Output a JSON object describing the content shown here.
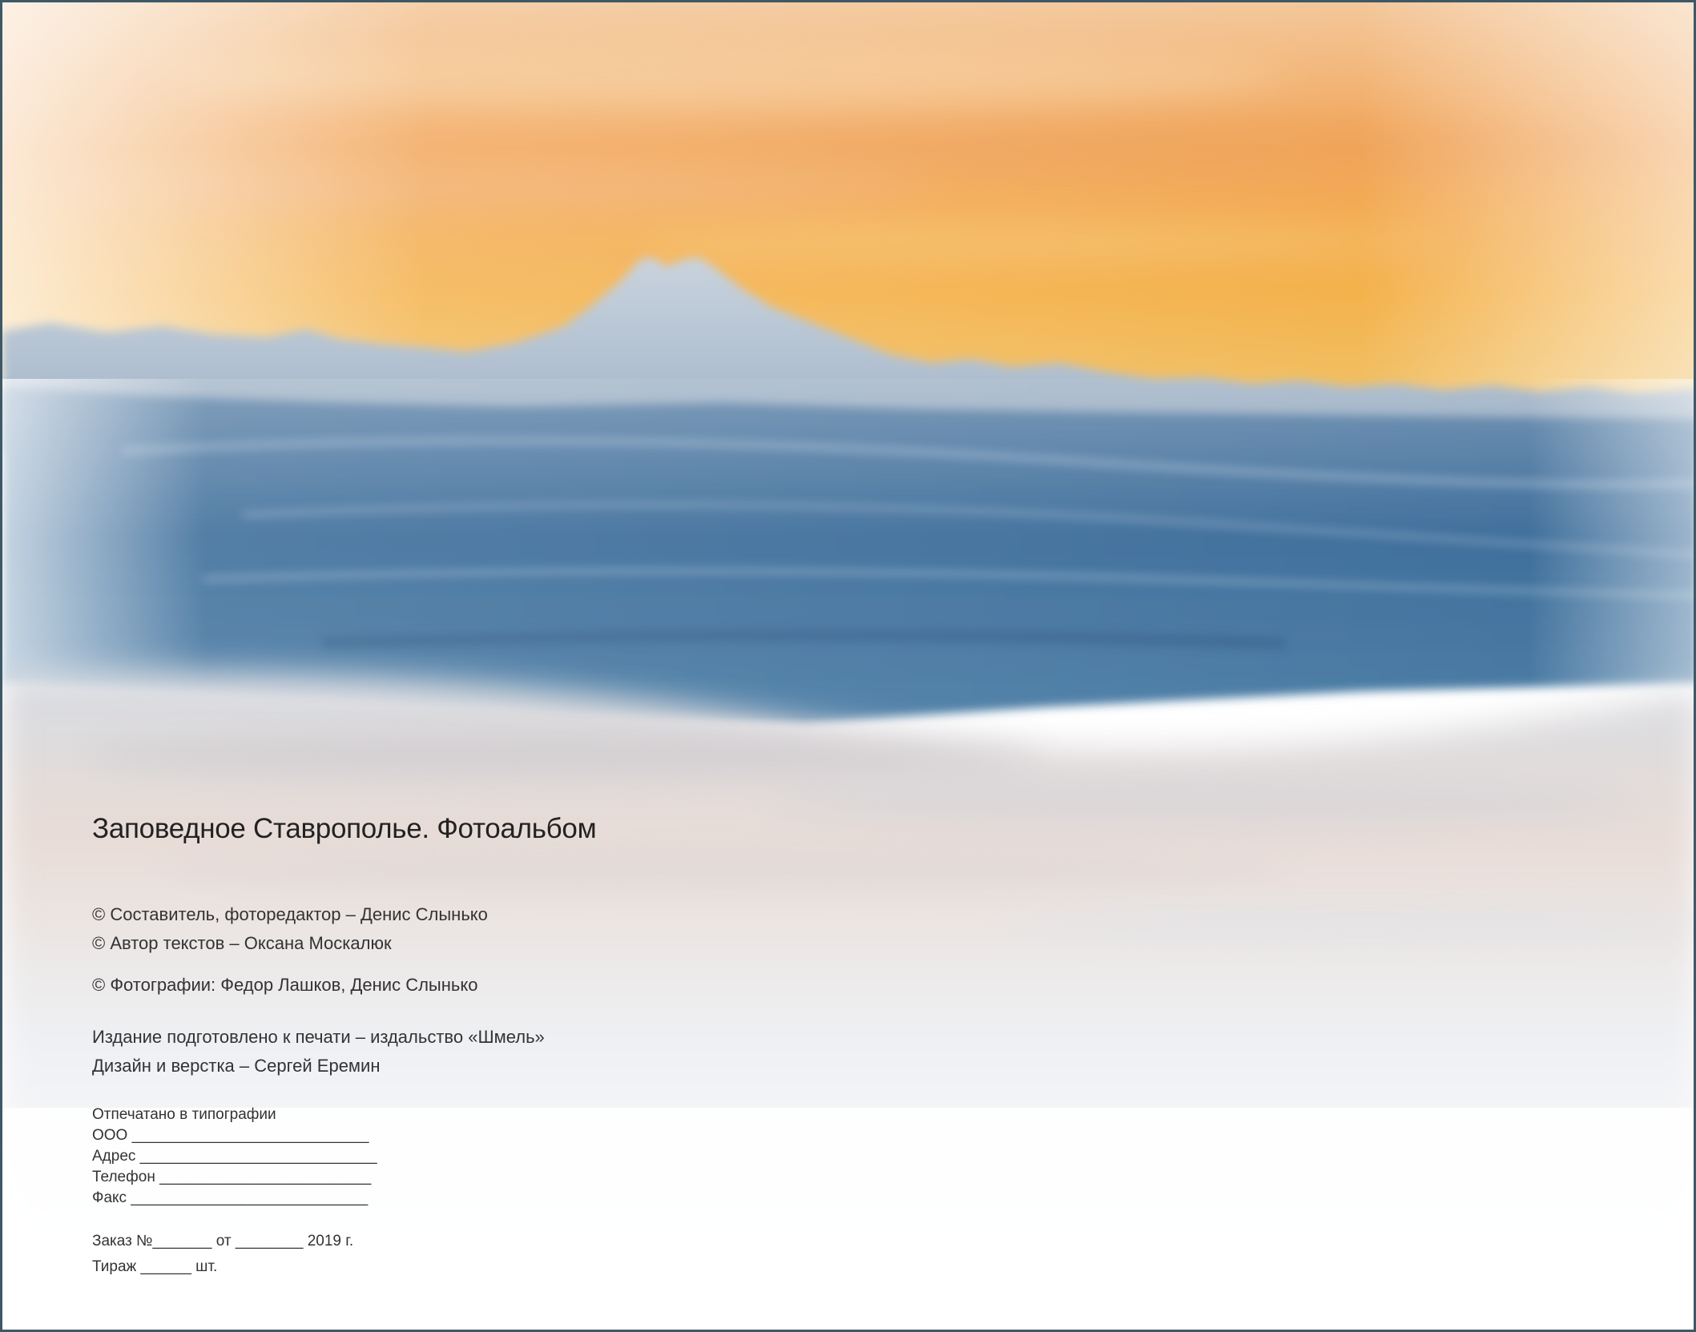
{
  "title": "Заповедное Ставрополье. Фотоальбом",
  "credits": {
    "compiler": "© Составитель, фоторедактор – Денис Слынько",
    "text_author": "© Автор текстов – Оксана Москалюк",
    "photos": "© Фотографии: Федор Лашков, Денис Слынько",
    "prepared": "Издание подготовлено к печати – издальство «Шмель»",
    "design": "Дизайн и верстка – Сергей Еремин"
  },
  "printing": {
    "heading": "Отпечатано в типографии",
    "company": "ООО ____________________________",
    "address": "Адрес ____________________________",
    "phone": "Телефон _________________________",
    "fax": "Факс ____________________________"
  },
  "order": {
    "order_line": "Заказ №_______ от ________ 2019 г.",
    "circulation": "Тираж ______ шт."
  },
  "colors": {
    "border": "#3f5866",
    "sky_orange": "#f2a24e",
    "mountain_blue": "#4f7fa8",
    "text": "#2b2b2b"
  }
}
